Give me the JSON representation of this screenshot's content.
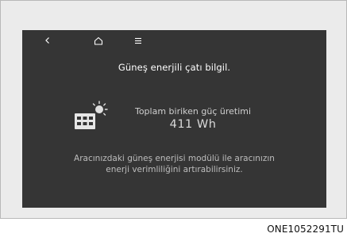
{
  "nav": {
    "back_icon": "chevron-left-icon",
    "home_icon": "home-icon",
    "menu_icon": "menu-icon"
  },
  "screen": {
    "title": "Güneş enerjili çatı bilgil.",
    "stat_label": "Toplam biriken güç üretimi",
    "stat_value": "411 Wh",
    "description_line1": "Aracınızdaki güneş enerjisi modülü ile aracınızın",
    "description_line2": "enerji verimliliğini artırabilirsiniz.",
    "solar_icon": "solar-panel-sun-icon"
  },
  "figure_code": "ONE1052291TU",
  "colors": {
    "screen_bg": "#353535",
    "frame_bg": "#ebebeb",
    "text": "#ffffff",
    "muted_text": "#bdbdbd"
  }
}
